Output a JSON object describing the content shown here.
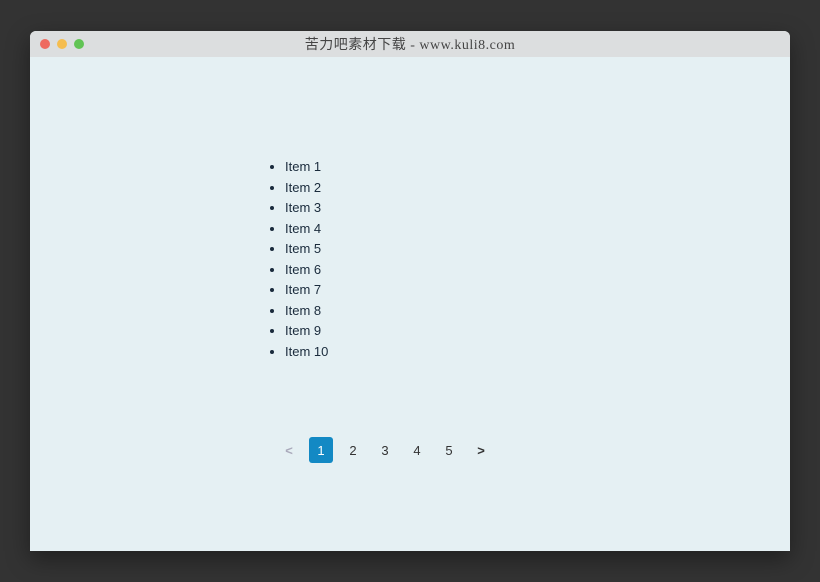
{
  "window": {
    "title": "苦力吧素材下载 - www.kuli8.com"
  },
  "items": [
    "Item 1",
    "Item 2",
    "Item 3",
    "Item 4",
    "Item 5",
    "Item 6",
    "Item 7",
    "Item 8",
    "Item 9",
    "Item 10"
  ],
  "pagination": {
    "prev": "<",
    "next": ">",
    "pages": [
      "1",
      "2",
      "3",
      "4",
      "5"
    ],
    "current": 1
  }
}
